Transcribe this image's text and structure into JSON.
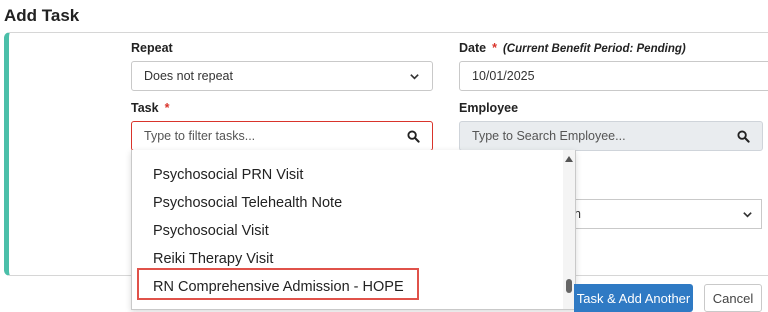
{
  "page": {
    "title": "Add Task"
  },
  "repeat": {
    "label": "Repeat",
    "value": "Does not repeat"
  },
  "date": {
    "label": "Date",
    "required_mark": "*",
    "note": "(Current Benefit Period: Pending)",
    "value": "10/01/2025"
  },
  "task": {
    "label": "Task",
    "required_mark": "*",
    "placeholder": "Type to filter tasks..."
  },
  "employee": {
    "label": "Employee",
    "placeholder": "Type to Search Employee..."
  },
  "task_options": {
    "items": [
      "Psychosocial PRN Visit",
      "Psychosocial Telehealth Note",
      "Psychosocial Visit",
      "Reiki Therapy Visit",
      "RN Comprehensive Admission - HOPE"
    ],
    "highlighted": "RN Comprehensive Admission - HOPE"
  },
  "hidden_select": {
    "value_fragment": "n"
  },
  "actions": {
    "add_another_label": "Task & Add Another",
    "cancel_label": "Cancel"
  },
  "colors": {
    "accent": "#4bbfa9",
    "required": "#d9342b",
    "primary_button": "#2f7ac4",
    "highlight_box": "#e0524a"
  },
  "icons": {
    "search": "search-icon",
    "dropdown": "chevron-down-icon",
    "scroll_up": "scroll-up-arrow-icon"
  }
}
